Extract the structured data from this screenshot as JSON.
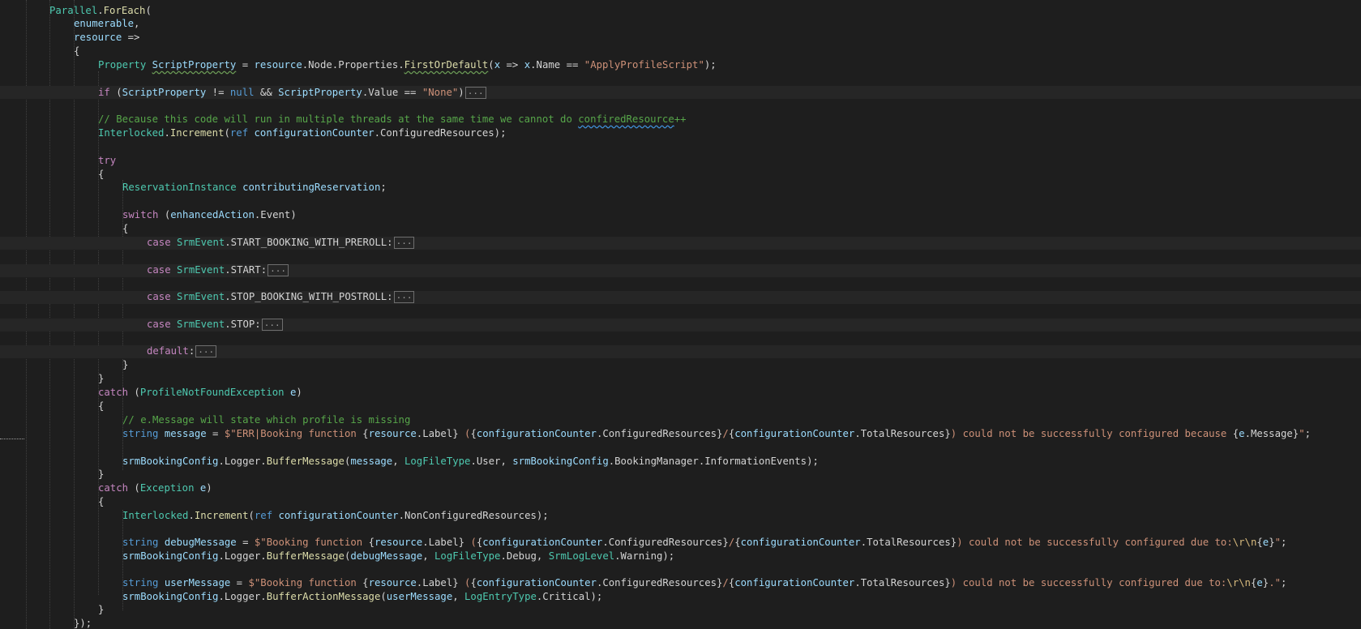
{
  "editor": {
    "colors": {
      "background": "#1e1e1e",
      "keyword": "#569cd6",
      "control": "#c586c0",
      "type": "#4ec9b0",
      "variable": "#9cdcfe",
      "method": "#dcdcaa",
      "string": "#ce9178",
      "comment": "#57a64a",
      "text": "#d4d4d4"
    },
    "lines": [
      [
        {
          "t": "Parallel",
          "c": "type"
        },
        {
          "t": ".",
          "c": "txt"
        },
        {
          "t": "ForEach",
          "c": "fn"
        },
        {
          "t": "(",
          "c": "txt"
        }
      ],
      [
        {
          "t": "enumerable",
          "c": "var"
        },
        {
          "t": ",",
          "c": "txt"
        }
      ],
      [
        {
          "t": "resource",
          "c": "var"
        },
        {
          "t": " =>",
          "c": "txt"
        }
      ],
      [
        {
          "t": "{",
          "c": "txt"
        }
      ],
      [
        {
          "t": "Property",
          "c": "type"
        },
        {
          "t": " ",
          "c": "txt"
        },
        {
          "t": "ScriptProperty",
          "c": "var",
          "u": "green"
        },
        {
          "t": " = ",
          "c": "txt"
        },
        {
          "t": "resource",
          "c": "var"
        },
        {
          "t": ".",
          "c": "txt"
        },
        {
          "t": "Node",
          "c": "txt"
        },
        {
          "t": ".",
          "c": "txt"
        },
        {
          "t": "Properties",
          "c": "txt"
        },
        {
          "t": ".",
          "c": "txt"
        },
        {
          "t": "FirstOrDefault",
          "c": "fn",
          "u": "green"
        },
        {
          "t": "(",
          "c": "txt"
        },
        {
          "t": "x",
          "c": "var"
        },
        {
          "t": " => ",
          "c": "txt"
        },
        {
          "t": "x",
          "c": "var"
        },
        {
          "t": ".",
          "c": "txt"
        },
        {
          "t": "Name",
          "c": "txt"
        },
        {
          "t": " == ",
          "c": "txt"
        },
        {
          "t": "\"ApplyProfileScript\"",
          "c": "str"
        },
        {
          "t": ");",
          "c": "txt"
        }
      ],
      [
        {
          "t": "if",
          "c": "ctl"
        },
        {
          "t": " (",
          "c": "txt"
        },
        {
          "t": "ScriptProperty",
          "c": "var"
        },
        {
          "t": " != ",
          "c": "txt"
        },
        {
          "t": "null",
          "c": "kw"
        },
        {
          "t": " && ",
          "c": "txt"
        },
        {
          "t": "ScriptProperty",
          "c": "var"
        },
        {
          "t": ".",
          "c": "txt"
        },
        {
          "t": "Value",
          "c": "txt"
        },
        {
          "t": " == ",
          "c": "txt"
        },
        {
          "t": "\"None\"",
          "c": "str"
        },
        {
          "t": ")",
          "c": "txt"
        },
        {
          "t": "...",
          "c": "fold"
        }
      ],
      [
        {
          "t": "// Because this code will run in multiple threads at the same time we cannot do ",
          "c": "cmt"
        },
        {
          "t": "confiredResource",
          "c": "cmt",
          "u": "blue"
        },
        {
          "t": "++",
          "c": "cmt"
        }
      ],
      [
        {
          "t": "Interlocked",
          "c": "type"
        },
        {
          "t": ".",
          "c": "txt"
        },
        {
          "t": "Increment",
          "c": "fn"
        },
        {
          "t": "(",
          "c": "txt"
        },
        {
          "t": "ref",
          "c": "kw"
        },
        {
          "t": " ",
          "c": "txt"
        },
        {
          "t": "configurationCounter",
          "c": "var"
        },
        {
          "t": ".",
          "c": "txt"
        },
        {
          "t": "ConfiguredResources",
          "c": "txt"
        },
        {
          "t": ");",
          "c": "txt"
        }
      ],
      [
        {
          "t": "try",
          "c": "ctl"
        }
      ],
      [
        {
          "t": "{",
          "c": "txt"
        }
      ],
      [
        {
          "t": "ReservationInstance",
          "c": "type"
        },
        {
          "t": " ",
          "c": "txt"
        },
        {
          "t": "contributingReservation",
          "c": "var"
        },
        {
          "t": ";",
          "c": "txt"
        }
      ],
      [
        {
          "t": "switch",
          "c": "ctl"
        },
        {
          "t": " (",
          "c": "txt"
        },
        {
          "t": "enhancedAction",
          "c": "var"
        },
        {
          "t": ".",
          "c": "txt"
        },
        {
          "t": "Event",
          "c": "txt"
        },
        {
          "t": ")",
          "c": "txt"
        }
      ],
      [
        {
          "t": "{",
          "c": "txt"
        }
      ],
      [
        {
          "t": "case",
          "c": "ctl"
        },
        {
          "t": " ",
          "c": "txt"
        },
        {
          "t": "SrmEvent",
          "c": "type"
        },
        {
          "t": ".",
          "c": "txt"
        },
        {
          "t": "START_BOOKING_WITH_PREROLL",
          "c": "txt"
        },
        {
          "t": ":",
          "c": "txt"
        },
        {
          "t": "...",
          "c": "fold"
        }
      ],
      [
        {
          "t": "case",
          "c": "ctl"
        },
        {
          "t": " ",
          "c": "txt"
        },
        {
          "t": "SrmEvent",
          "c": "type"
        },
        {
          "t": ".",
          "c": "txt"
        },
        {
          "t": "START",
          "c": "txt"
        },
        {
          "t": ":",
          "c": "txt"
        },
        {
          "t": "...",
          "c": "fold"
        }
      ],
      [
        {
          "t": "case",
          "c": "ctl"
        },
        {
          "t": " ",
          "c": "txt"
        },
        {
          "t": "SrmEvent",
          "c": "type"
        },
        {
          "t": ".",
          "c": "txt"
        },
        {
          "t": "STOP_BOOKING_WITH_POSTROLL",
          "c": "txt"
        },
        {
          "t": ":",
          "c": "txt"
        },
        {
          "t": "...",
          "c": "fold"
        }
      ],
      [
        {
          "t": "case",
          "c": "ctl"
        },
        {
          "t": " ",
          "c": "txt"
        },
        {
          "t": "SrmEvent",
          "c": "type"
        },
        {
          "t": ".",
          "c": "txt"
        },
        {
          "t": "STOP",
          "c": "txt"
        },
        {
          "t": ":",
          "c": "txt"
        },
        {
          "t": "...",
          "c": "fold"
        }
      ],
      [
        {
          "t": "default",
          "c": "ctl"
        },
        {
          "t": ":",
          "c": "txt"
        },
        {
          "t": "...",
          "c": "fold"
        }
      ],
      [
        {
          "t": "}",
          "c": "txt"
        }
      ],
      [
        {
          "t": "}",
          "c": "txt"
        }
      ],
      [
        {
          "t": "catch",
          "c": "ctl"
        },
        {
          "t": " (",
          "c": "txt"
        },
        {
          "t": "ProfileNotFoundException",
          "c": "type"
        },
        {
          "t": " ",
          "c": "txt"
        },
        {
          "t": "e",
          "c": "var"
        },
        {
          "t": ")",
          "c": "txt"
        }
      ],
      [
        {
          "t": "{",
          "c": "txt"
        }
      ],
      [
        {
          "t": "// e.Message will state which profile is missing",
          "c": "cmt"
        }
      ],
      [
        {
          "t": "string",
          "c": "kw"
        },
        {
          "t": " ",
          "c": "txt"
        },
        {
          "t": "message",
          "c": "var"
        },
        {
          "t": " = ",
          "c": "txt"
        },
        {
          "t": "$\"ERR|Booking function ",
          "c": "str"
        },
        {
          "t": "{",
          "c": "txt"
        },
        {
          "t": "resource",
          "c": "var"
        },
        {
          "t": ".",
          "c": "txt"
        },
        {
          "t": "Label",
          "c": "txt"
        },
        {
          "t": "}",
          "c": "txt"
        },
        {
          "t": " (",
          "c": "str"
        },
        {
          "t": "{",
          "c": "txt"
        },
        {
          "t": "configurationCounter",
          "c": "var"
        },
        {
          "t": ".",
          "c": "txt"
        },
        {
          "t": "ConfiguredResources",
          "c": "txt"
        },
        {
          "t": "}",
          "c": "txt"
        },
        {
          "t": "/",
          "c": "str"
        },
        {
          "t": "{",
          "c": "txt"
        },
        {
          "t": "configurationCounter",
          "c": "var"
        },
        {
          "t": ".",
          "c": "txt"
        },
        {
          "t": "TotalResources",
          "c": "txt"
        },
        {
          "t": "}",
          "c": "txt"
        },
        {
          "t": ") could not be successfully configured because ",
          "c": "str"
        },
        {
          "t": "{",
          "c": "txt"
        },
        {
          "t": "e",
          "c": "var"
        },
        {
          "t": ".",
          "c": "txt"
        },
        {
          "t": "Message",
          "c": "txt"
        },
        {
          "t": "}",
          "c": "txt"
        },
        {
          "t": "\"",
          "c": "str"
        },
        {
          "t": ";",
          "c": "txt"
        }
      ],
      [
        {
          "t": "srmBookingConfig",
          "c": "var"
        },
        {
          "t": ".",
          "c": "txt"
        },
        {
          "t": "Logger",
          "c": "txt"
        },
        {
          "t": ".",
          "c": "txt"
        },
        {
          "t": "BufferMessage",
          "c": "fn"
        },
        {
          "t": "(",
          "c": "txt"
        },
        {
          "t": "message",
          "c": "var"
        },
        {
          "t": ", ",
          "c": "txt"
        },
        {
          "t": "LogFileType",
          "c": "type"
        },
        {
          "t": ".",
          "c": "txt"
        },
        {
          "t": "User",
          "c": "txt"
        },
        {
          "t": ", ",
          "c": "txt"
        },
        {
          "t": "srmBookingConfig",
          "c": "var"
        },
        {
          "t": ".",
          "c": "txt"
        },
        {
          "t": "BookingManager",
          "c": "txt"
        },
        {
          "t": ".",
          "c": "txt"
        },
        {
          "t": "InformationEvents",
          "c": "txt"
        },
        {
          "t": ");",
          "c": "txt"
        }
      ],
      [
        {
          "t": "}",
          "c": "txt"
        }
      ],
      [
        {
          "t": "catch",
          "c": "ctl"
        },
        {
          "t": " (",
          "c": "txt"
        },
        {
          "t": "Exception",
          "c": "type"
        },
        {
          "t": " ",
          "c": "txt"
        },
        {
          "t": "e",
          "c": "var"
        },
        {
          "t": ")",
          "c": "txt"
        }
      ],
      [
        {
          "t": "{",
          "c": "txt"
        }
      ],
      [
        {
          "t": "Interlocked",
          "c": "type"
        },
        {
          "t": ".",
          "c": "txt"
        },
        {
          "t": "Increment",
          "c": "fn"
        },
        {
          "t": "(",
          "c": "txt"
        },
        {
          "t": "ref",
          "c": "kw"
        },
        {
          "t": " ",
          "c": "txt"
        },
        {
          "t": "configurationCounter",
          "c": "var"
        },
        {
          "t": ".",
          "c": "txt"
        },
        {
          "t": "NonConfiguredResources",
          "c": "txt"
        },
        {
          "t": ");",
          "c": "txt"
        }
      ],
      [
        {
          "t": "string",
          "c": "kw"
        },
        {
          "t": " ",
          "c": "txt"
        },
        {
          "t": "debugMessage",
          "c": "var"
        },
        {
          "t": " = ",
          "c": "txt"
        },
        {
          "t": "$\"Booking function ",
          "c": "str"
        },
        {
          "t": "{",
          "c": "txt"
        },
        {
          "t": "resource",
          "c": "var"
        },
        {
          "t": ".",
          "c": "txt"
        },
        {
          "t": "Label",
          "c": "txt"
        },
        {
          "t": "}",
          "c": "txt"
        },
        {
          "t": " (",
          "c": "str"
        },
        {
          "t": "{",
          "c": "txt"
        },
        {
          "t": "configurationCounter",
          "c": "var"
        },
        {
          "t": ".",
          "c": "txt"
        },
        {
          "t": "ConfiguredResources",
          "c": "txt"
        },
        {
          "t": "}",
          "c": "txt"
        },
        {
          "t": "/",
          "c": "str"
        },
        {
          "t": "{",
          "c": "txt"
        },
        {
          "t": "configurationCounter",
          "c": "var"
        },
        {
          "t": ".",
          "c": "txt"
        },
        {
          "t": "TotalResources",
          "c": "txt"
        },
        {
          "t": "}",
          "c": "txt"
        },
        {
          "t": ") could not be successfully configured due to:",
          "c": "str"
        },
        {
          "t": "\\r\\n",
          "c": "esc"
        },
        {
          "t": "{",
          "c": "txt"
        },
        {
          "t": "e",
          "c": "var"
        },
        {
          "t": "}",
          "c": "txt"
        },
        {
          "t": "\"",
          "c": "str"
        },
        {
          "t": ";",
          "c": "txt"
        }
      ],
      [
        {
          "t": "srmBookingConfig",
          "c": "var"
        },
        {
          "t": ".",
          "c": "txt"
        },
        {
          "t": "Logger",
          "c": "txt"
        },
        {
          "t": ".",
          "c": "txt"
        },
        {
          "t": "BufferMessage",
          "c": "fn"
        },
        {
          "t": "(",
          "c": "txt"
        },
        {
          "t": "debugMessage",
          "c": "var"
        },
        {
          "t": ", ",
          "c": "txt"
        },
        {
          "t": "LogFileType",
          "c": "type"
        },
        {
          "t": ".",
          "c": "txt"
        },
        {
          "t": "Debug",
          "c": "txt"
        },
        {
          "t": ", ",
          "c": "txt"
        },
        {
          "t": "SrmLogLevel",
          "c": "type"
        },
        {
          "t": ".",
          "c": "txt"
        },
        {
          "t": "Warning",
          "c": "txt"
        },
        {
          "t": ");",
          "c": "txt"
        }
      ],
      [
        {
          "t": "string",
          "c": "kw"
        },
        {
          "t": " ",
          "c": "txt"
        },
        {
          "t": "userMessage",
          "c": "var"
        },
        {
          "t": " = ",
          "c": "txt"
        },
        {
          "t": "$\"Booking function ",
          "c": "str"
        },
        {
          "t": "{",
          "c": "txt"
        },
        {
          "t": "resource",
          "c": "var"
        },
        {
          "t": ".",
          "c": "txt"
        },
        {
          "t": "Label",
          "c": "txt"
        },
        {
          "t": "}",
          "c": "txt"
        },
        {
          "t": " (",
          "c": "str"
        },
        {
          "t": "{",
          "c": "txt"
        },
        {
          "t": "configurationCounter",
          "c": "var"
        },
        {
          "t": ".",
          "c": "txt"
        },
        {
          "t": "ConfiguredResources",
          "c": "txt"
        },
        {
          "t": "}",
          "c": "txt"
        },
        {
          "t": "/",
          "c": "str"
        },
        {
          "t": "{",
          "c": "txt"
        },
        {
          "t": "configurationCounter",
          "c": "var"
        },
        {
          "t": ".",
          "c": "txt"
        },
        {
          "t": "TotalResources",
          "c": "txt"
        },
        {
          "t": "}",
          "c": "txt"
        },
        {
          "t": ") could not be successfully configured due to:",
          "c": "str"
        },
        {
          "t": "\\r\\n",
          "c": "esc"
        },
        {
          "t": "{",
          "c": "txt"
        },
        {
          "t": "e",
          "c": "var"
        },
        {
          "t": "}",
          "c": "txt"
        },
        {
          "t": ".\"",
          "c": "str"
        },
        {
          "t": ";",
          "c": "txt"
        }
      ],
      [
        {
          "t": "srmBookingConfig",
          "c": "var"
        },
        {
          "t": ".",
          "c": "txt"
        },
        {
          "t": "Logger",
          "c": "txt"
        },
        {
          "t": ".",
          "c": "txt"
        },
        {
          "t": "BufferActionMessage",
          "c": "fn"
        },
        {
          "t": "(",
          "c": "txt"
        },
        {
          "t": "userMessage",
          "c": "var"
        },
        {
          "t": ", ",
          "c": "txt"
        },
        {
          "t": "LogEntryType",
          "c": "type"
        },
        {
          "t": ".",
          "c": "txt"
        },
        {
          "t": "Critical",
          "c": "txt"
        },
        {
          "t": ");",
          "c": "txt"
        }
      ],
      [
        {
          "t": "}",
          "c": "txt"
        }
      ],
      [
        {
          "t": "});",
          "c": "txt"
        }
      ]
    ]
  }
}
